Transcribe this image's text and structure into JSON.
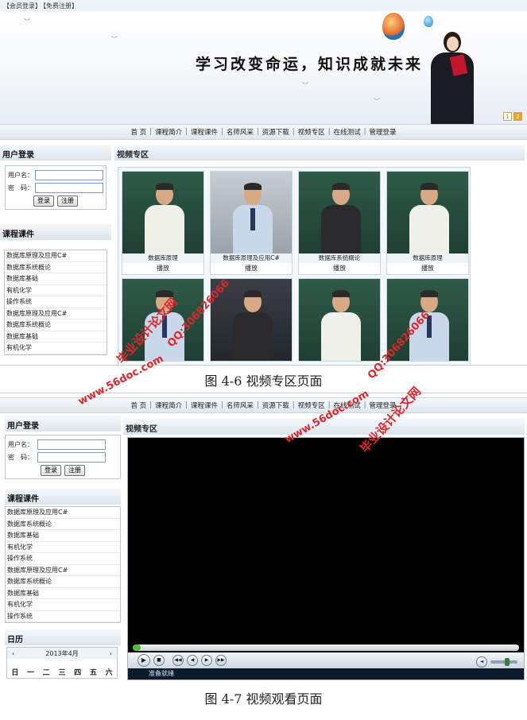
{
  "shot1": {
    "topbar": {
      "member_login": "【会员登录】",
      "free_register": "【免费注册】"
    },
    "banner": {
      "slogan": "学习改变命运，知识成就未来",
      "pager": [
        "1",
        "2"
      ]
    },
    "nav": [
      "首 页",
      "课程简介",
      "课程课件",
      "名师风采",
      "资源下载",
      "视频专区",
      "在线测试",
      "管理登录"
    ],
    "sidebar": {
      "login_title": "用户登录",
      "username_label": "用户名：",
      "password_label": "密　码：",
      "login_button": "登录",
      "register_button": "注册",
      "courses_title": "课程课件",
      "courses": [
        "数据库原理及应用C#",
        "数据库系统概论",
        "数据库基础",
        "有机化学",
        "操作系统",
        "数据库原理及应用C#",
        "数据库系统概论",
        "数据库基础",
        "有机化学"
      ]
    },
    "main": {
      "title": "视频专区",
      "videos": [
        {
          "label": "数据库原理",
          "play": "播放"
        },
        {
          "label": "数据库原理及应用C#",
          "play": "播放"
        },
        {
          "label": "数据库系统概论",
          "play": "播放"
        },
        {
          "label": "数据库原理",
          "play": "播放"
        },
        {
          "label": "",
          "play": ""
        },
        {
          "label": "",
          "play": ""
        },
        {
          "label": "",
          "play": ""
        },
        {
          "label": "",
          "play": ""
        }
      ]
    },
    "caption": "图 4-6 视频专区页面"
  },
  "shot2": {
    "nav": [
      "首 页",
      "课程简介",
      "课程课件",
      "名师风采",
      "资源下载",
      "视频专区",
      "在线测试",
      "管理登录"
    ],
    "sidebar": {
      "login_title": "用户登录",
      "username_label": "用户名：",
      "password_label": "密　码：",
      "login_button": "登录",
      "register_button": "注册",
      "courses_title": "课程课件",
      "courses": [
        "数据库原理及应用C#",
        "数据库系统概论",
        "数据库基础",
        "有机化学",
        "操作系统",
        "数据库原理及应用C#",
        "数据库系统概论",
        "数据库基础",
        "有机化学",
        "操作系统"
      ],
      "calendar_title": "日历",
      "calendar_month": "2013年4月",
      "calendar_prev": "‹",
      "calendar_next": "›",
      "weekdays": [
        "日",
        "一",
        "二",
        "三",
        "四",
        "五",
        "六"
      ]
    },
    "main": {
      "title": "视频专区"
    },
    "player": {
      "status": "准备就绪",
      "progress_fraction": 0.02
    },
    "caption": "图 4-7 视频观看页面"
  },
  "watermarks": [
    "毕业设计论文网",
    "www.56doc.com",
    "QQ:306826066"
  ],
  "colors": {
    "watermark": "#e0262b",
    "player_bg": "#000000",
    "progress_fill": "#4fbf3a"
  }
}
